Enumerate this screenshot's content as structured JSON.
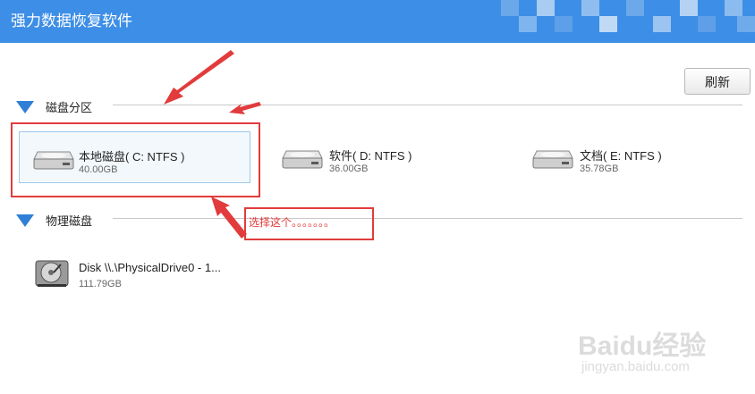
{
  "window": {
    "title": "强力数据恢复软件"
  },
  "toolbar": {
    "refresh_label": "刷新"
  },
  "partitions": {
    "heading": "磁盘分区",
    "items": [
      {
        "name": "本地磁盘( C: NTFS )",
        "size": "40.00GB",
        "selected": true
      },
      {
        "name": "软件( D: NTFS )",
        "size": "36.00GB",
        "selected": false
      },
      {
        "name": "文档( E: NTFS )",
        "size": "35.78GB",
        "selected": false
      }
    ]
  },
  "physical": {
    "heading": "物理磁盘",
    "items": [
      {
        "name": "Disk \\\\.\\PhysicalDrive0 - 1...",
        "size": "111.79GB"
      }
    ]
  },
  "annotation": {
    "text": "选择这个。。。。。。。",
    "color": "#e23b3b"
  },
  "watermark": {
    "logo": "Baidu经验",
    "url": "jingyan.baidu.com"
  },
  "colors": {
    "titlebar": "#3d8ee6",
    "accent": "#2f7fd6",
    "selection_border": "#9cc8ee",
    "annotation": "#e23b3b"
  }
}
